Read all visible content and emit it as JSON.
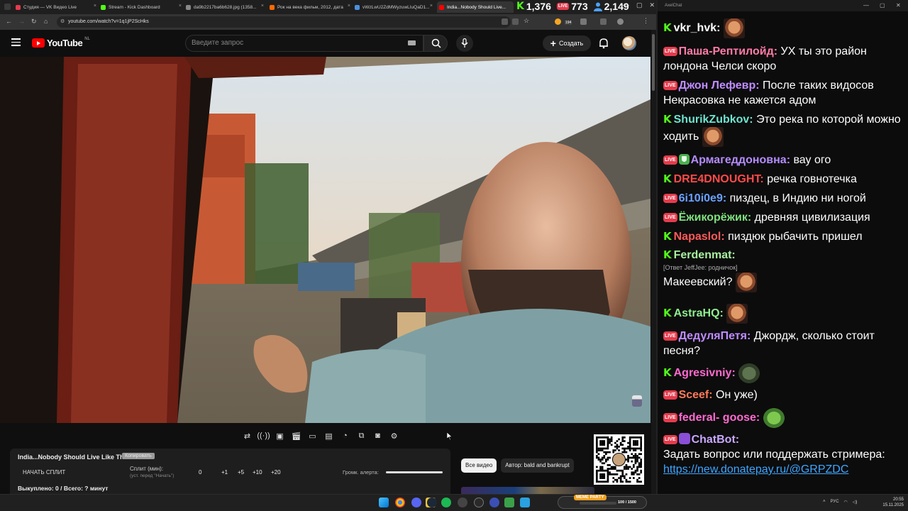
{
  "browser": {
    "tabs": [
      {
        "title": "Студия — VK Видео Live",
        "color": "#e53b4d"
      },
      {
        "title": "Stream - Kick Dashboard",
        "color": "#53fc18"
      },
      {
        "title": "da9b2217ba6b628.jpg (1358...",
        "color": "#888888"
      },
      {
        "title": "Рок на века фильм, 2012, дата",
        "color": "#ff6a00"
      },
      {
        "title": "vWzLwU2ZdMWyzuwLIuQaD1...",
        "color": "#4a90e2"
      },
      {
        "title": "India...Nobody Should Live...",
        "color": "#ff0000"
      }
    ],
    "url": "youtube.com/watch?v=1q1jP2ScHks",
    "ext_badge": "194"
  },
  "stats": {
    "kick": "1,376",
    "vk": "773",
    "viewers": "2,149",
    "live_label": "LIVE"
  },
  "youtube": {
    "logo": "YouTube",
    "region": "NL",
    "search_placeholder": "Введите запрос",
    "create": "Создать"
  },
  "video_controls": {
    "title": "India...Nobody Should Live Like This",
    "badge": "Копировать",
    "split_button": "НАЧАТЬ СПЛИТ",
    "split_label": "Сплит (мин):",
    "split_hint": "(уст. перед \"Начать\")",
    "split_value": "0",
    "increments": [
      "+1",
      "+5",
      "+10",
      "+20"
    ],
    "alert_label": "Громк. алерта:",
    "alert_volume": 1.0,
    "bought": "Выкуплено: 0 / Всего: ? минут"
  },
  "chips": {
    "all": "Все видео",
    "author": "Автор: bald and bankrupt"
  },
  "chat": {
    "window_title": "AxelChat",
    "messages": [
      {
        "platform": "kick",
        "name": "vkr_hvk:",
        "color": "#ffffff",
        "text": "",
        "emote": "face"
      },
      {
        "platform": "vk",
        "name": "Паша-Рептилойд:",
        "color": "#ff7aa8",
        "text": "УХ ты это район лондона Челси скоро"
      },
      {
        "platform": "vk",
        "name": "Джон Лефевр:",
        "color": "#c08cff",
        "text": "После таких видосов Некрасовка не кажется адом"
      },
      {
        "platform": "kick",
        "name": "ShurikZubkov:",
        "color": "#6ee4d0",
        "text": "Это река по которой можно ходить",
        "emote": "face"
      },
      {
        "platform": "vk",
        "name": "Армагеддоновна:",
        "color": "#b58cff",
        "text": "вау ого",
        "shield": true
      },
      {
        "platform": "kick",
        "name": "DRE4DNOUGHT:",
        "color": "#ff4a4a",
        "text": "речка говнотечка"
      },
      {
        "platform": "vk",
        "name": "6i10i0e9:",
        "color": "#6aa0ff",
        "text": "пиздец, в Индию ни ногой"
      },
      {
        "platform": "vk",
        "name": "Ёжикорёжик:",
        "color": "#7fe07f",
        "text": "древняя цивилизация"
      },
      {
        "platform": "kick",
        "name": "Napaslol:",
        "color": "#ff5a5a",
        "text": "пиздюк рыбачить пришел"
      },
      {
        "platform": "kick",
        "name": "Ferdenmat:",
        "color": "#a8f0a0",
        "text": "",
        "reply": "[Ответ JeffJee: родничок]",
        "text2": "Макеевский?",
        "emote": "face"
      },
      {
        "platform": "kick",
        "name": "AstraHQ:",
        "color": "#8ff08f",
        "text": "",
        "emote": "face"
      },
      {
        "platform": "vk",
        "name": "ДедуляПетя:",
        "color": "#c08cff",
        "text": "Джордж, сколько стоит песня?"
      },
      {
        "platform": "kick",
        "name": "Agresivniy:",
        "color": "#ff6ad0",
        "text": "",
        "emote": "grey"
      },
      {
        "platform": "vk",
        "name": "Sceef:",
        "color": "#ff7a5a",
        "text": "Он уже)"
      },
      {
        "platform": "vk",
        "name": "federal- goose:",
        "color": "#ff6ad0",
        "text": "",
        "emote": "frog"
      },
      {
        "platform": "vk",
        "name": "ChatBot:",
        "color": "#c9a8ff",
        "text": "Задать вопрос или поддержать стримера:",
        "link": "https://new.donatepay.ru/@GRPZDC",
        "bot": true
      }
    ]
  },
  "taskbar": {
    "meme_tag": "MEME PARTY",
    "meme_count": "100 / 1500",
    "lang": "РУС",
    "time": "20:55",
    "date": "15.11.2025"
  },
  "icons": {
    "tools": [
      "repeat-icon",
      "broadcast-icon",
      "cast-icon",
      "clapper-icon",
      "window-icon",
      "subtitles-icon",
      "speed-icon",
      "pip-icon",
      "camera-icon",
      "gear-icon"
    ]
  }
}
